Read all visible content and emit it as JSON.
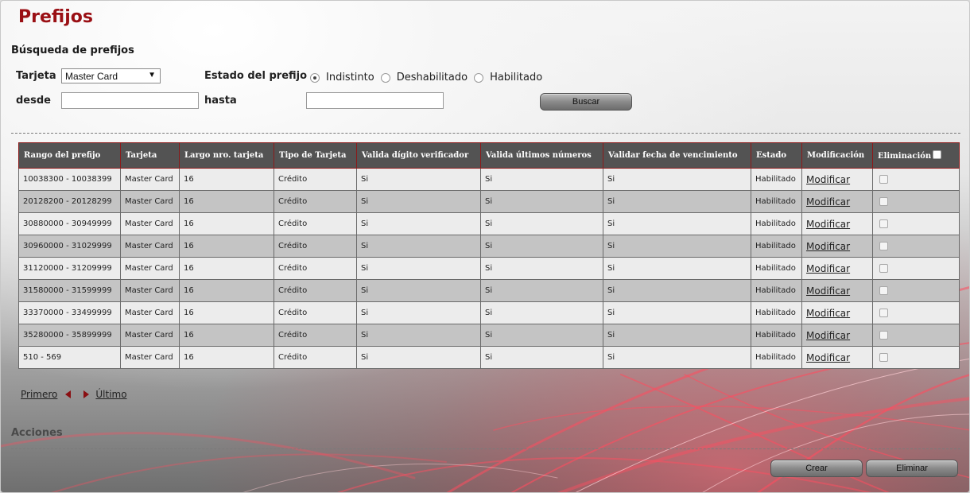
{
  "page": {
    "title": "Prefijos"
  },
  "search": {
    "section_title": "Búsqueda de prefijos",
    "card_label": "Tarjeta",
    "card_selected": "Master Card",
    "status_label": "Estado del prefijo",
    "status_options": [
      "Indistinto",
      "Deshabilitado",
      "Habilitado"
    ],
    "status_selected": "Indistinto",
    "from_label": "desde",
    "to_label": "hasta",
    "from_value": "",
    "to_value": "",
    "search_button": "Buscar"
  },
  "table": {
    "columns": [
      "Rango del prefijo",
      "Tarjeta",
      "Largo nro. tarjeta",
      "Tipo de Tarjeta",
      "Valida dígito verificador",
      "Valida últimos números",
      "Validar fecha de vencimiento",
      "Estado",
      "Modificación",
      "Eliminación"
    ],
    "rows": [
      {
        "range": "10038300 - 10038399",
        "card": "Master Card",
        "length": "16",
        "type": "Crédito",
        "check_digit": "Si",
        "last_numbers": "Si",
        "expiry": "Si",
        "status": "Habilitado",
        "modify": "Modificar"
      },
      {
        "range": "20128200 - 20128299",
        "card": "Master Card",
        "length": "16",
        "type": "Crédito",
        "check_digit": "Si",
        "last_numbers": "Si",
        "expiry": "Si",
        "status": "Habilitado",
        "modify": "Modificar"
      },
      {
        "range": "30880000 - 30949999",
        "card": "Master Card",
        "length": "16",
        "type": "Crédito",
        "check_digit": "Si",
        "last_numbers": "Si",
        "expiry": "Si",
        "status": "Habilitado",
        "modify": "Modificar"
      },
      {
        "range": "30960000 - 31029999",
        "card": "Master Card",
        "length": "16",
        "type": "Crédito",
        "check_digit": "Si",
        "last_numbers": "Si",
        "expiry": "Si",
        "status": "Habilitado",
        "modify": "Modificar"
      },
      {
        "range": "31120000 - 31209999",
        "card": "Master Card",
        "length": "16",
        "type": "Crédito",
        "check_digit": "Si",
        "last_numbers": "Si",
        "expiry": "Si",
        "status": "Habilitado",
        "modify": "Modificar"
      },
      {
        "range": "31580000 - 31599999",
        "card": "Master Card",
        "length": "16",
        "type": "Crédito",
        "check_digit": "Si",
        "last_numbers": "Si",
        "expiry": "Si",
        "status": "Habilitado",
        "modify": "Modificar"
      },
      {
        "range": "33370000 - 33499999",
        "card": "Master Card",
        "length": "16",
        "type": "Crédito",
        "check_digit": "Si",
        "last_numbers": "Si",
        "expiry": "Si",
        "status": "Habilitado",
        "modify": "Modificar"
      },
      {
        "range": "35280000 - 35899999",
        "card": "Master Card",
        "length": "16",
        "type": "Crédito",
        "check_digit": "Si",
        "last_numbers": "Si",
        "expiry": "Si",
        "status": "Habilitado",
        "modify": "Modificar"
      },
      {
        "range": "510 - 569",
        "card": "Master Card",
        "length": "16",
        "type": "Crédito",
        "check_digit": "Si",
        "last_numbers": "Si",
        "expiry": "Si",
        "status": "Habilitado",
        "modify": "Modificar"
      }
    ]
  },
  "pager": {
    "first": "Primero",
    "last": "Último"
  },
  "actions": {
    "title": "Acciones",
    "create_button": "Crear",
    "delete_button": "Eliminar"
  },
  "colors": {
    "title_red": "#9a0f14",
    "header_bg": "#535353",
    "row_alt": "#c4c4c4",
    "accent_red": "#e63a4a"
  }
}
